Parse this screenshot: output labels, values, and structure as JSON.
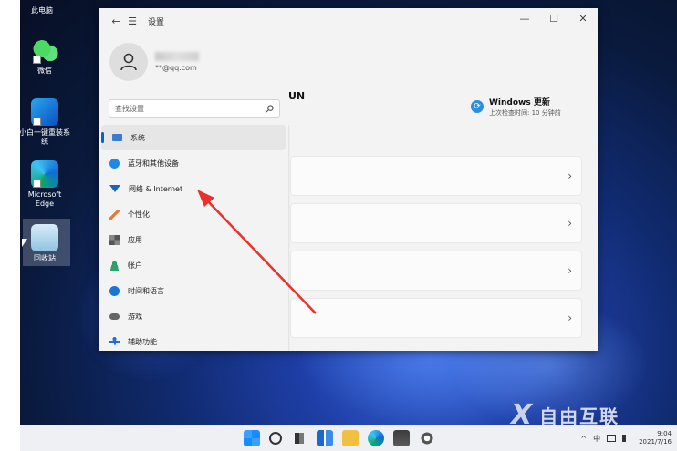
{
  "desktop": {
    "top_label": "此电脑",
    "icons": [
      {
        "label": "微信"
      },
      {
        "label": "小白一键重装系统"
      },
      {
        "label": "Microsoft Edge"
      },
      {
        "label": "回收站"
      }
    ]
  },
  "settings": {
    "title": "设置",
    "back_glyph": "←",
    "menu_glyph": "☰",
    "controls": {
      "minimize": "—",
      "maximize": "☐",
      "close": "✕"
    },
    "profile": {
      "email": "   **@qq.com"
    },
    "search": {
      "placeholder": "查找设置",
      "icon": "search-icon"
    },
    "nav": [
      {
        "label": "系统",
        "icon": "monitor-icon",
        "color": "#3a7bd5"
      },
      {
        "label": "蓝牙和其他设备",
        "icon": "bluetooth-icon",
        "color": "#1e88e5"
      },
      {
        "label": "网络 & Internet",
        "icon": "network-icon",
        "color": "#1565c0"
      },
      {
        "label": "个性化",
        "icon": "brush-icon",
        "color": "#e07b39"
      },
      {
        "label": "应用",
        "icon": "apps-icon",
        "color": "#555555"
      },
      {
        "label": "帐户",
        "icon": "account-icon",
        "color": "#2e9e6b"
      },
      {
        "label": "时间和语言",
        "icon": "globe-clock-icon",
        "color": "#1976d2"
      },
      {
        "label": "游戏",
        "icon": "gamepad-icon",
        "color": "#666666"
      },
      {
        "label": "辅助功能",
        "icon": "accessibility-icon",
        "color": "#1e6fd9"
      }
    ],
    "main": {
      "heading": "UN",
      "update_title": "Windows 更新",
      "update_sub": "上次检查时间: 10 分钟前",
      "update_glyph": "⟳",
      "chevron": "›"
    }
  },
  "taskbar": {
    "tray": {
      "chevron": "^",
      "ime": "中"
    },
    "clock_time": "9:04",
    "clock_date": "2021/7/16"
  },
  "watermark": {
    "mark": "X",
    "text": "自由互联"
  },
  "colors": {
    "accent": "#0067c0",
    "arrow": "#e8322b"
  }
}
